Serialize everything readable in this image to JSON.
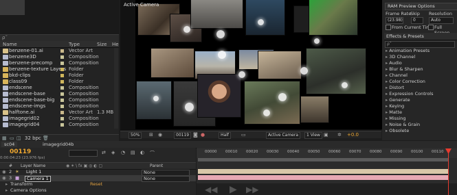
{
  "project": {
    "search_placeholder": "ρ˜",
    "columns": {
      "name": "Name",
      "type": "Type",
      "size": "Size",
      "extra": "He"
    },
    "items": [
      {
        "name": "benzene-01.ai",
        "type": "Vector Art",
        "size": "",
        "icon": "file-icon",
        "color": "#d9c28a",
        "swatch": "#c9b88a"
      },
      {
        "name": "benzene3D",
        "type": "Composition",
        "size": "",
        "icon": "comp-icon",
        "color": "#b7bcd0",
        "swatch": "#c9c59a"
      },
      {
        "name": "benzene-precomp",
        "type": "Composition",
        "size": "",
        "icon": "comp-icon",
        "color": "#b7bcd0",
        "swatch": "#c9c59a"
      },
      {
        "name": "benzene-texture Layers",
        "type": "Folder",
        "size": "",
        "icon": "folder-icon",
        "color": "#d8b45a",
        "swatch": "#d0b75c"
      },
      {
        "name": "bkd-clips",
        "type": "Folder",
        "size": "",
        "icon": "folder-icon",
        "color": "#d8b45a",
        "swatch": "#d0b75c"
      },
      {
        "name": "class09",
        "type": "Folder",
        "size": "",
        "icon": "folder-icon",
        "color": "#d8b45a",
        "swatch": "#d0b75c"
      },
      {
        "name": "endscene",
        "type": "Composition",
        "size": "",
        "icon": "comp-icon",
        "color": "#b7bcd0",
        "swatch": "#c9c59a"
      },
      {
        "name": "endscene-base",
        "type": "Composition",
        "size": "",
        "icon": "comp-icon",
        "color": "#b7bcd0",
        "swatch": "#c9c59a"
      },
      {
        "name": "endscene-base-big",
        "type": "Composition",
        "size": "",
        "icon": "comp-icon",
        "color": "#b7bcd0",
        "swatch": "#c9c59a"
      },
      {
        "name": "endscene-imgs",
        "type": "Composition",
        "size": "",
        "icon": "comp-icon",
        "color": "#b7bcd0",
        "swatch": "#c9c59a"
      },
      {
        "name": "halftone.ai",
        "type": "Vector Art",
        "size": "1.3 MB",
        "icon": "file-icon",
        "color": "#d9c28a",
        "swatch": "#c9b88a"
      },
      {
        "name": "imagegrid02",
        "type": "Composition",
        "size": "",
        "icon": "comp-icon",
        "color": "#b7bcd0",
        "swatch": "#c9c59a"
      },
      {
        "name": "imagegrid04",
        "type": "Composition",
        "size": "",
        "icon": "comp-icon",
        "color": "#b7bcd0",
        "swatch": "#c9c59a"
      }
    ],
    "footer_bpc": "32 bpc"
  },
  "viewer": {
    "title": "Active Camera",
    "zoom": "50%",
    "frame": "00119",
    "resolution": "Half",
    "camera": "Active Camera",
    "views": "1 View",
    "exposure": "+0.0"
  },
  "preview": {
    "title": "RAM Preview Options",
    "frame_rate_label": "Frame Rate",
    "skip_label": "Skip",
    "resolution_label": "Resolution",
    "frame_rate": "(23.98)",
    "skip": "0",
    "resolution": "Auto",
    "from_current": "From Current Time",
    "full_screen": "Full Screen"
  },
  "effects": {
    "title": "Effects & Presets",
    "search_placeholder": "ρ˜",
    "items": [
      "Animation Presets",
      "3D Channel",
      "Audio",
      "Blur & Sharpen",
      "Channel",
      "Color Correction",
      "Distort",
      "Expression Controls",
      "Generate",
      "Keying",
      "Matte",
      "Missing",
      "Noise & Grain",
      "Obsolete"
    ]
  },
  "timeline": {
    "tabs": [
      "sc04",
      "imagegrid04b"
    ],
    "timecode": "00119",
    "fps": "0:00:04:23 (23.976 fps)",
    "columns": {
      "num": "#",
      "layer": "Layer Name",
      "parent": "Parent"
    },
    "layers": [
      {
        "num": "2",
        "name": "Light 1",
        "parent": "None"
      },
      {
        "num": "3",
        "name": "Camera 1",
        "parent": "None"
      }
    ],
    "transform_label": "Transform",
    "reset_label": "Reset",
    "camera_options_label": "Camera Options",
    "ruler_ticks": [
      "00000",
      "00010",
      "00020",
      "00030",
      "00040",
      "00050",
      "00060",
      "00070",
      "00080",
      "00090",
      "00100",
      "00110"
    ]
  }
}
